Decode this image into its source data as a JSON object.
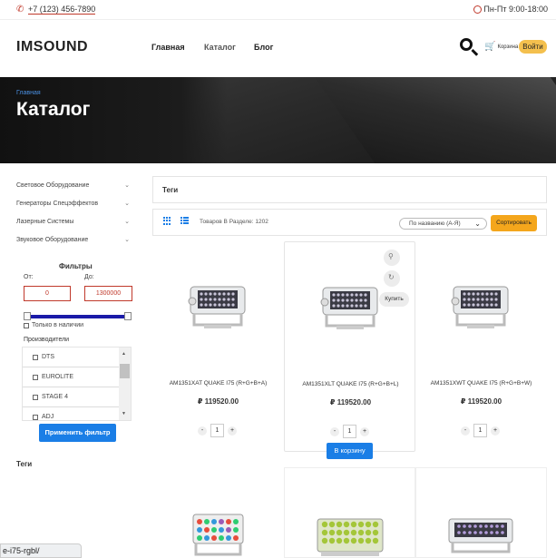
{
  "topbar": {
    "phone": "+7 (123) 456-7890",
    "hours": "Пн-Пт 9:00-18:00"
  },
  "header": {
    "logo": "IMSOUND",
    "nav": [
      "Главная",
      "Каталог",
      "Блог"
    ],
    "cart_label": "Корзина",
    "login_label": "Войти"
  },
  "hero": {
    "breadcrumb": "Главная",
    "title": "Каталог"
  },
  "sidebar": {
    "categories": [
      "Световое Оборудование",
      "Генераторы Спецэффектов",
      "Лазерные Системы",
      "Звуковое Оборудование"
    ],
    "filters_title": "Фильтры",
    "from_label": "От:",
    "to_label": "До:",
    "from_value": "0",
    "to_value": "1300000",
    "in_stock_label": "Только в наличии",
    "makers_title": "Производители",
    "makers": [
      "DTS",
      "EUROLITE",
      "STAGE 4",
      "ADJ"
    ],
    "apply_label": "Применить фильтр",
    "tags_title": "Теги"
  },
  "main": {
    "tags_title": "Теги",
    "count_label": "Товаров В Разделе: 1202",
    "sort_value": "По названию (А-Я)",
    "sort_button": "Сортировать"
  },
  "products": [
    {
      "name": "AM1351XAT QUAKE I75 (R+G+B+A)",
      "price": "₽ 119520.00",
      "qty": "1"
    },
    {
      "name": "AM1351XLT QUAKE I75 (R+G+B+L)",
      "price": "₽ 119520.00",
      "qty": "1",
      "buy_label": "Купить",
      "cart_label": "В корзину"
    },
    {
      "name": "AM1351XWT QUAKE I75 (R+G+B+W)",
      "price": "₽ 119520.00",
      "qty": "1"
    }
  ],
  "status_bar": {
    "url": "e-i75-rgbl/"
  },
  "colors": {
    "accent_blue": "#1a7ee6",
    "accent_yellow": "#f4c04e",
    "accent_red": "#c0392b"
  }
}
